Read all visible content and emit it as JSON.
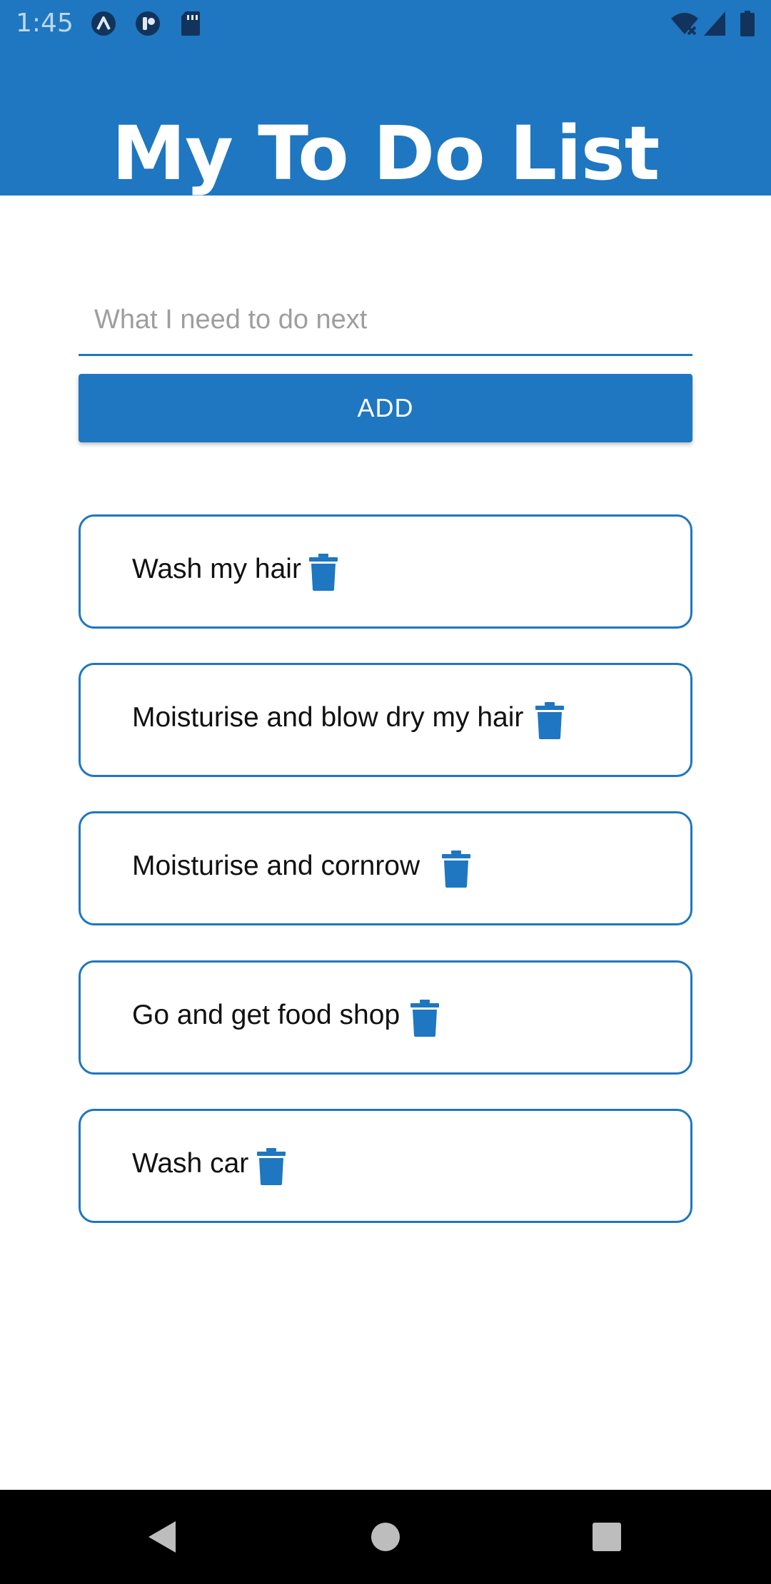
{
  "status_bar": {
    "time": "1:45",
    "left_icons": [
      "arrow-up-circle-icon",
      "circle-badge-icon",
      "sd-card-icon"
    ],
    "right_icons": [
      "wifi-off-icon",
      "signal-icon",
      "battery-icon"
    ]
  },
  "header": {
    "title": "My To Do List",
    "background_color": "#1e77c0"
  },
  "input": {
    "placeholder": "What I need to do next",
    "value": ""
  },
  "add_button": {
    "label": "ADD"
  },
  "todos": [
    {
      "text": "Wash my hair",
      "icon": "trash-icon"
    },
    {
      "text": "Moisturise and blow dry my hair",
      "icon": "trash-icon"
    },
    {
      "text": "Moisturise and cornrow",
      "icon": "trash-icon"
    },
    {
      "text": "Go and get food shop",
      "icon": "trash-icon"
    },
    {
      "text": "Wash car",
      "icon": "trash-icon"
    }
  ],
  "navigation": {
    "buttons": [
      "back-icon",
      "home-icon",
      "recents-icon"
    ]
  },
  "colors": {
    "accent": "#1e77c0",
    "background": "#ffffff",
    "nav_bar": "#000000"
  }
}
